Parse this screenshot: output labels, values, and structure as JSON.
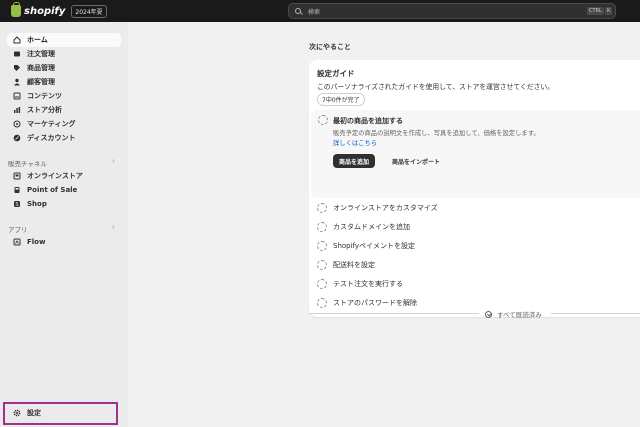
{
  "topbar": {
    "brand": "shopify",
    "edition_badge": "2024年夏",
    "search_placeholder": "検索",
    "shortcut_key1": "CTRL",
    "shortcut_key2": "K"
  },
  "sidebar": {
    "main_items": [
      {
        "label": "ホーム",
        "icon": "home-icon"
      },
      {
        "label": "注文管理",
        "icon": "orders-icon"
      },
      {
        "label": "商品管理",
        "icon": "tag-icon"
      },
      {
        "label": "顧客管理",
        "icon": "person-icon"
      },
      {
        "label": "コンテンツ",
        "icon": "content-icon"
      },
      {
        "label": "ストア分析",
        "icon": "chart-icon"
      },
      {
        "label": "マーケティング",
        "icon": "target-icon"
      },
      {
        "label": "ディスカウント",
        "icon": "discount-icon"
      }
    ],
    "sales_channels_label": "販売チャネル",
    "sales_channels": [
      {
        "label": "オンラインストア",
        "icon": "store-icon"
      },
      {
        "label": "Point of Sale",
        "icon": "pos-icon"
      },
      {
        "label": "Shop",
        "icon": "shop-icon"
      }
    ],
    "apps_label": "アプリ",
    "apps": [
      {
        "label": "Flow",
        "icon": "flow-icon"
      }
    ],
    "settings_label": "設定"
  },
  "main": {
    "todo_heading": "次にやること",
    "guide": {
      "title": "設定ガイド",
      "description": "このパーソナライズされたガイドを使用して、ストアを運営させてください。",
      "progress": "7中0件が完了",
      "expanded_task": {
        "title": "最初の商品を追加する",
        "description": "販売予定の商品の説明文を作成し、写真を追加して、価格を設定します。",
        "link": "詳しくはこちら",
        "primary_button": "商品を追加",
        "secondary_button": "商品をインポート"
      },
      "tasks": [
        "オンラインストアをカスタマイズ",
        "カスタムドメインを追加",
        "Shopifyペイメントを設定",
        "配送料を設定",
        "テスト注文を実行する",
        "ストアのパスワードを解除"
      ]
    },
    "mark_all_read": "すべて既読済み"
  }
}
